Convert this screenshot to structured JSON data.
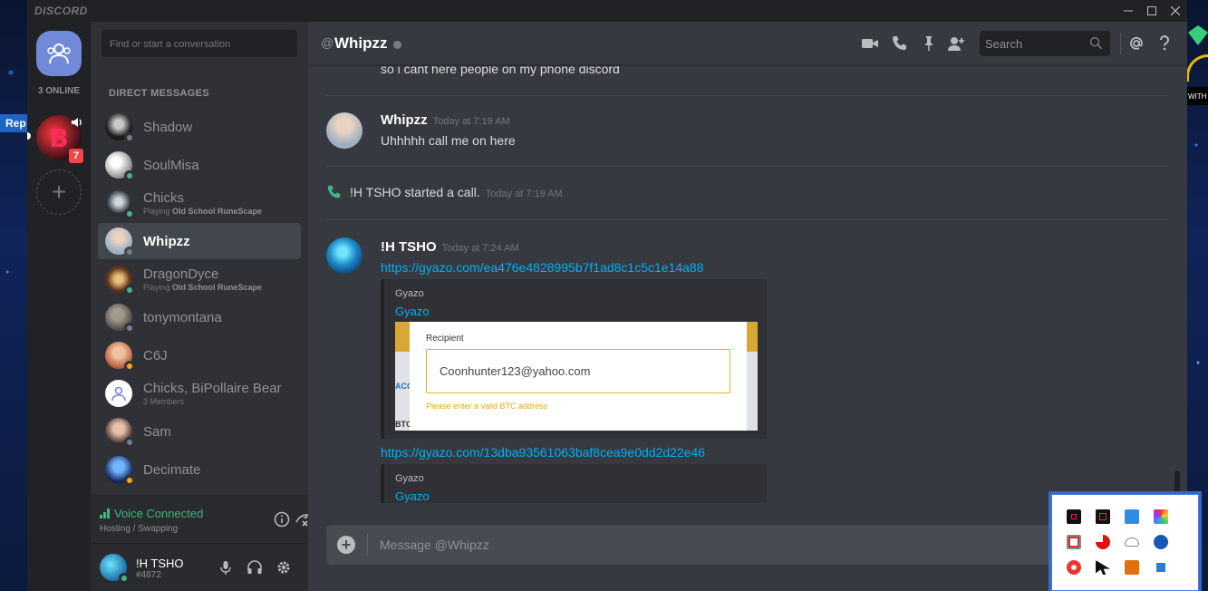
{
  "window": {
    "app_name": "DISCORD"
  },
  "desktop": {
    "left_tag": "Rep",
    "right_tag": "WITH"
  },
  "guilds": {
    "online_count": "3 ONLINE",
    "server_badge": "7"
  },
  "sidebar": {
    "search_placeholder": "Find or start a conversation",
    "section_title": "DIRECT MESSAGES",
    "dms": [
      {
        "name": "Shadow",
        "sub": "",
        "status": "offline",
        "color": "#1b1b1b"
      },
      {
        "name": "SoulMisa",
        "sub": "",
        "status": "online",
        "color": "#d6d6d6"
      },
      {
        "name": "Chicks",
        "sub_prefix": "Playing ",
        "sub_game": "Old School RuneScape",
        "status": "online",
        "color": "#2a2f36"
      },
      {
        "name": "Whipzz",
        "sub": "",
        "status": "offline",
        "color": "#b7c3d0",
        "active": true
      },
      {
        "name": "DragonDyce",
        "sub_prefix": "Playing ",
        "sub_game": "Old School RuneScape",
        "status": "online",
        "color": "#5a3318"
      },
      {
        "name": "tonymontana",
        "sub": "",
        "status": "offline",
        "color": "#6f6a64"
      },
      {
        "name": "C6J",
        "sub": "",
        "status": "idle",
        "color": "#d99577"
      },
      {
        "name": "Chicks, BiPollaire Bear",
        "sub": "3 Members",
        "status": "",
        "color": "#ffffff"
      },
      {
        "name": "Sam",
        "sub": "",
        "status": "offline",
        "color": "#a06a5a"
      },
      {
        "name": "Decimate",
        "sub": "",
        "status": "idle",
        "color": "#1b3a8a"
      }
    ],
    "voice": {
      "title": "Voice Connected",
      "channel": "Hosting / Swapping"
    },
    "user": {
      "name": "!H TSHO",
      "tag": "#4872"
    }
  },
  "chat": {
    "header": {
      "at": "@",
      "title": "Whipzz",
      "search_placeholder": "Search"
    },
    "messages": {
      "continued_text": "so i cant here people on my phone discord",
      "m1": {
        "author": "Whipzz",
        "time": "Today at 7:19 AM",
        "text": "Uhhhhh call me on here"
      },
      "call": {
        "text": "!H TSHO started a call.",
        "time": "Today at 7:19 AM"
      },
      "m2": {
        "author": "!H TSHO",
        "time": "Today at 7:24 AM",
        "link1": "https://gyazo.com/ea476e4828995b7f1ad8c1c5c1e14a88",
        "embed1": {
          "provider": "Gyazo",
          "title": "Gyazo",
          "image": {
            "field_label": "Recipient",
            "field_value": "Coonhunter123@yahoo.com",
            "error": "Please enter a valid BTC address",
            "left_text_1": "ACC",
            "left_text_2": "BTC"
          }
        },
        "link2": "https://gyazo.com/13dba93561063baf8cea9e0dd2d22e46",
        "embed2": {
          "provider": "Gyazo",
          "title": "Gyazo"
        }
      }
    },
    "composer_placeholder": "Message @Whipzz"
  },
  "tray": {
    "icons": [
      "app-icon",
      "app-icon",
      "network-icon",
      "color-picker-icon",
      "shield-icon",
      "pie-chart-icon",
      "cloud-icon",
      "bluetooth-icon",
      "badge-icon",
      "cursor-icon",
      "lightning-icon",
      "window-icon"
    ]
  }
}
